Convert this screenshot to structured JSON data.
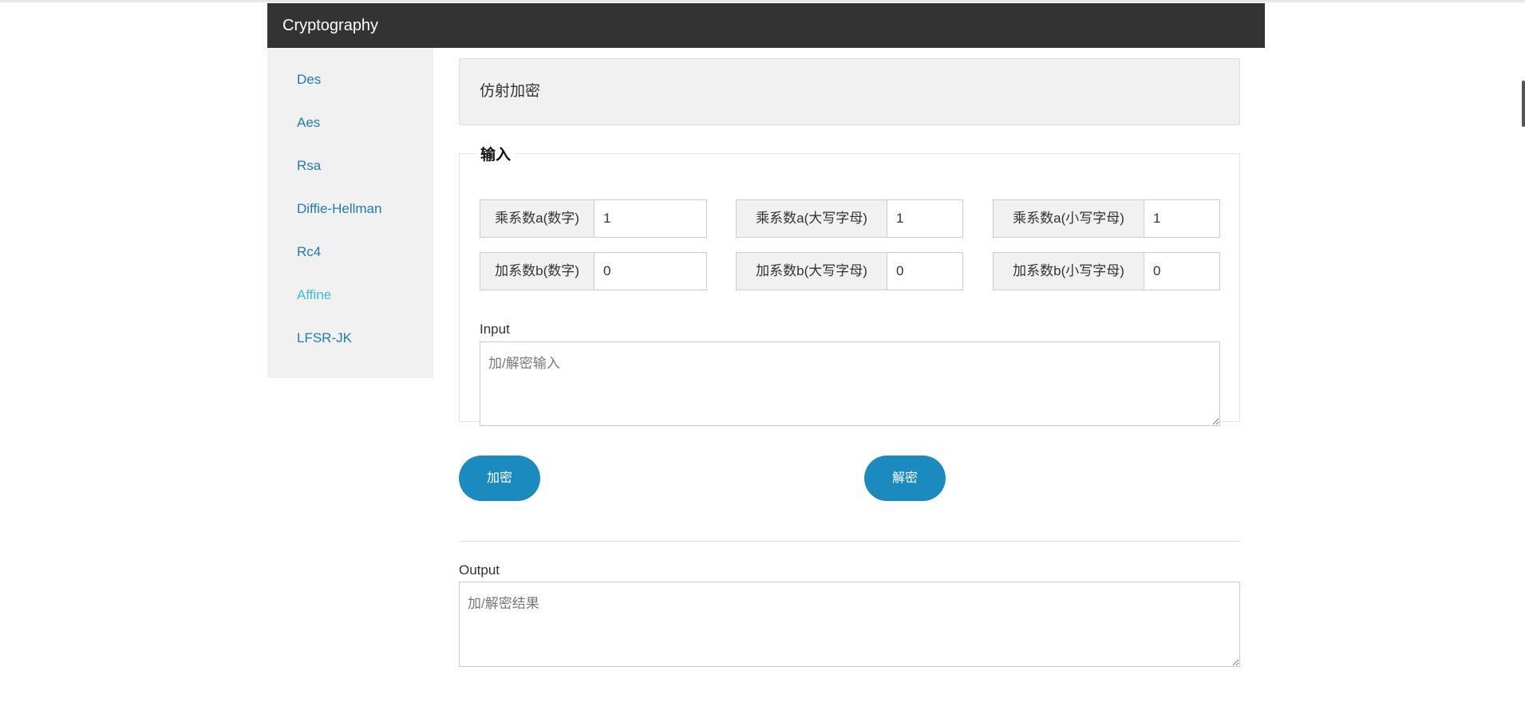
{
  "navbar": {
    "brand": "Cryptography"
  },
  "sidebar": {
    "items": [
      {
        "label": "Des"
      },
      {
        "label": "Aes"
      },
      {
        "label": "Rsa"
      },
      {
        "label": "Diffie-Hellman"
      },
      {
        "label": "Rc4"
      },
      {
        "label": "Affine",
        "active": true
      },
      {
        "label": "LFSR-JK"
      }
    ],
    "active_color": "#3dbbe0",
    "link_color": "#1a7eb0"
  },
  "main": {
    "title": "仿射加密",
    "fieldset_legend": "输入",
    "params": {
      "a_digit": {
        "label": "乘系数a(数字)",
        "value": "1"
      },
      "a_upper": {
        "label": "乘系数a(大写字母)",
        "value": "1"
      },
      "a_lower": {
        "label": "乘系数a(小写字母)",
        "value": "1"
      },
      "b_digit": {
        "label": "加系数b(数字)",
        "value": "0"
      },
      "b_upper": {
        "label": "加系数b(大写字母)",
        "value": "0"
      },
      "b_lower": {
        "label": "加系数b(小写字母)",
        "value": "0"
      }
    },
    "input": {
      "label": "Input",
      "placeholder": "加/解密输入"
    },
    "buttons": {
      "encrypt": "加密",
      "decrypt": "解密"
    },
    "output": {
      "label": "Output",
      "placeholder": "加/解密结果"
    },
    "button_color": "#1a8abf"
  }
}
